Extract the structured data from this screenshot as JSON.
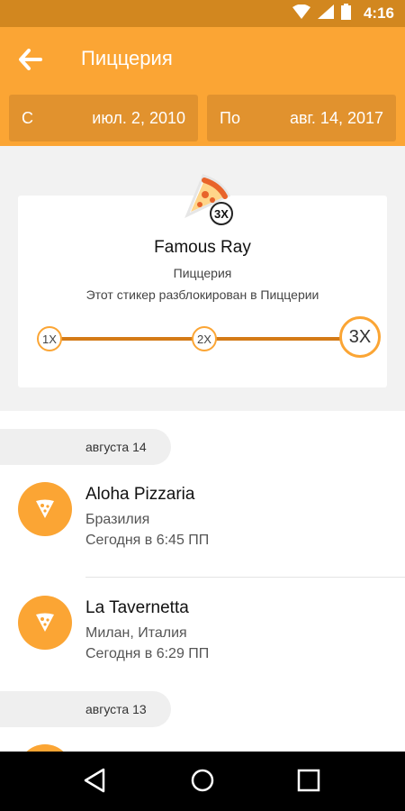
{
  "status_bar": {
    "time": "4:16"
  },
  "app_bar": {
    "title": "Пиццерия"
  },
  "date_range": {
    "from_label": "С",
    "from_value": "июл. 2, 2010",
    "to_label": "По",
    "to_value": "авг. 14, 2017"
  },
  "sticker": {
    "badge": "3X",
    "name": "Famous Ray",
    "category": "Пиццерия",
    "description": "Этот стикер разблокирован в Пиццерии",
    "levels": [
      "1X",
      "2X",
      "3X"
    ],
    "current_level": 3
  },
  "checkins": [
    {
      "date_header": "августа 14",
      "items": [
        {
          "name": "Aloha Pizzaria",
          "location": "Бразилия",
          "time": "Сегодня в 6:45 ПП"
        },
        {
          "name": "La Tavernetta",
          "location": "Милан, Италия",
          "time": "Сегодня в 6:29 ПП"
        }
      ]
    },
    {
      "date_header": "августа 13",
      "items": []
    }
  ],
  "colors": {
    "accent": "#fba534",
    "accent_dark": "#d2871f",
    "progress": "#d47a16",
    "background_gray": "#f2f2f2"
  }
}
